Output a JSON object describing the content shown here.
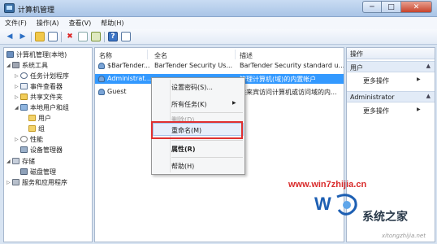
{
  "window": {
    "title": "计算机管理",
    "minimize": "─",
    "maximize": "□",
    "close": "✕"
  },
  "menubar": [
    "文件(F)",
    "操作(A)",
    "查看(V)",
    "帮助(H)"
  ],
  "toolbar": {
    "back": "◀",
    "forward": "▶",
    "delete": "✖",
    "help": "?"
  },
  "tree": {
    "root": "计算机管理(本地)",
    "system_tools": "系统工具",
    "task_scheduler": "任务计划程序",
    "event_viewer": "事件查看器",
    "shared_folders": "共享文件夹",
    "local_users_groups": "本地用户和组",
    "users": "用户",
    "groups": "组",
    "performance": "性能",
    "device_manager": "设备管理器",
    "storage": "存储",
    "disk_management": "磁盘管理",
    "services_apps": "服务和应用程序"
  },
  "list": {
    "headers": [
      "名称",
      "全名",
      "描述"
    ],
    "rows": [
      {
        "name": "$BarTender...",
        "fullname": "BarTender Security Us...",
        "desc": "BarTender Security standard u..."
      },
      {
        "name": "Administrat...",
        "fullname": "",
        "desc": "管理计算机(域)的内置帐户"
      },
      {
        "name": "Guest",
        "fullname": "",
        "desc": "供来宾访问计算机或访问域的内..."
      }
    ]
  },
  "context_menu": {
    "set_password": "设置密码(S)...",
    "all_tasks": "所有任务(K)",
    "delete": "删除(D)",
    "rename": "重命名(M)",
    "properties": "属性(R)",
    "help": "帮助(H)",
    "submenu_arrow": "▶"
  },
  "actions": {
    "title": "操作",
    "section1": "用户",
    "section2": "Administrator",
    "more": "更多操作",
    "collapse": "▲",
    "more_arrow": "▶"
  },
  "watermark": {
    "site": "www.win7zhijia.cn",
    "brand": "系统之家",
    "url": "xitongzhijia.net"
  }
}
